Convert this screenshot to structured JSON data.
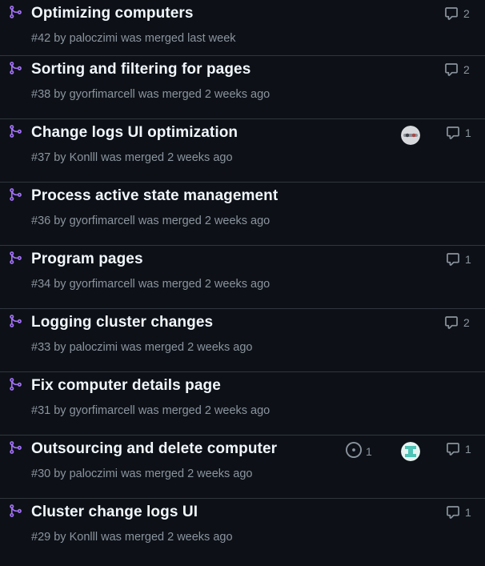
{
  "colors": {
    "background": "#0d1117",
    "merged_icon": "#a371f7",
    "title": "#f0f6fc",
    "meta": "#8b949e",
    "divider": "#30363d"
  },
  "pull_requests": [
    {
      "title": "Optimizing computers",
      "number": "#42",
      "by": "by",
      "author": "paloczimi",
      "status": "was merged last week",
      "comments": "2"
    },
    {
      "title": "Sorting and filtering for pages",
      "number": "#38",
      "by": "by",
      "author": "gyorfimarcell",
      "status": "was merged 2 weeks ago",
      "comments": "2"
    },
    {
      "title": "Change logs UI optimization",
      "number": "#37",
      "by": "by",
      "author": "Konlll",
      "status": "was merged 2 weeks ago",
      "comments": "1",
      "assignee_avatar": "avatar-gray"
    },
    {
      "title": "Process active state management",
      "number": "#36",
      "by": "by",
      "author": "gyorfimarcell",
      "status": "was merged 2 weeks ago"
    },
    {
      "title": "Program pages",
      "number": "#34",
      "by": "by",
      "author": "gyorfimarcell",
      "status": "was merged 2 weeks ago",
      "comments": "1"
    },
    {
      "title": "Logging cluster changes",
      "number": "#33",
      "by": "by",
      "author": "paloczimi",
      "status": "was merged 2 weeks ago",
      "comments": "2"
    },
    {
      "title": "Fix computer details page",
      "number": "#31",
      "by": "by",
      "author": "gyorfimarcell",
      "status": "was merged 2 weeks ago"
    },
    {
      "title": "Outsourcing and delete computer",
      "number": "#30",
      "by": "by",
      "author": "paloczimi",
      "status": "was merged 2 weeks ago",
      "comments": "1",
      "linked_issues": "1",
      "assignee_avatar": "avatar-teal"
    },
    {
      "title": "Cluster change logs UI",
      "number": "#29",
      "by": "by",
      "author": "Konlll",
      "status": "was merged 2 weeks ago",
      "comments": "1"
    }
  ]
}
